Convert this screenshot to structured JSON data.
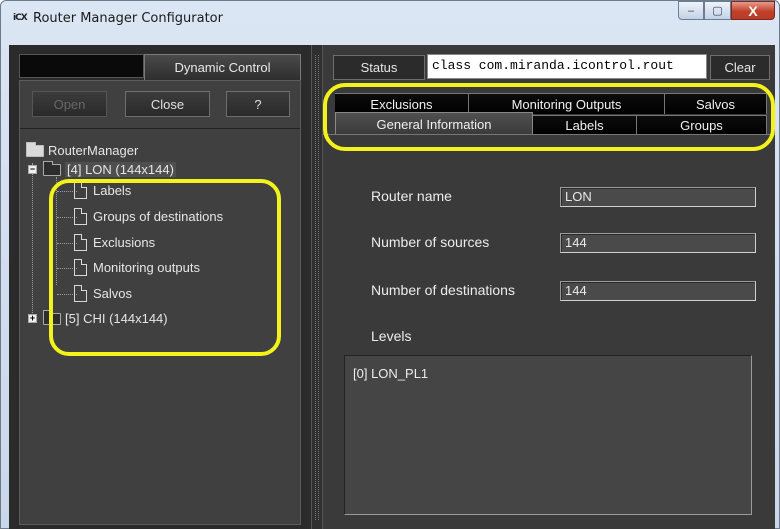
{
  "window": {
    "title": "Router Manager Configurator",
    "icon_text": "iCX",
    "controls": {
      "minimize": "–",
      "maximize": "▢",
      "close": "X"
    }
  },
  "left_panel": {
    "tab_label": "Dynamic Control",
    "buttons": {
      "open": "Open",
      "close": "Close",
      "help": "?"
    },
    "tree": {
      "root": "RouterManager",
      "routers": [
        {
          "label": "[4] LON (144x144)",
          "expander": "−",
          "expanded": true,
          "children": [
            "Labels",
            "Groups of destinations",
            "Exclusions",
            "Monitoring outputs",
            "Salvos"
          ]
        },
        {
          "label": "[5] CHI (144x144)",
          "expander": "+",
          "expanded": false
        }
      ]
    }
  },
  "right_panel": {
    "status_label": "Status",
    "status_text": "class com.miranda.icontrol.rout",
    "clear_label": "Clear",
    "tabs": {
      "row_back": [
        "Exclusions",
        "Monitoring Outputs",
        "Salvos"
      ],
      "row_front": [
        "General Information",
        "Labels",
        "Groups"
      ],
      "active": "General Information"
    },
    "form": {
      "router_name_label": "Router name",
      "router_name_value": "LON",
      "num_sources_label": "Number of sources",
      "num_sources_value": "144",
      "num_destinations_label": "Number of destinations",
      "num_destinations_value": "144",
      "levels_label": "Levels",
      "levels": [
        "[0] LON_PL1"
      ]
    }
  },
  "colors": {
    "highlight": "#f3f31b",
    "panel_bg": "#3a3a3a",
    "tab_bg": "#000000"
  }
}
